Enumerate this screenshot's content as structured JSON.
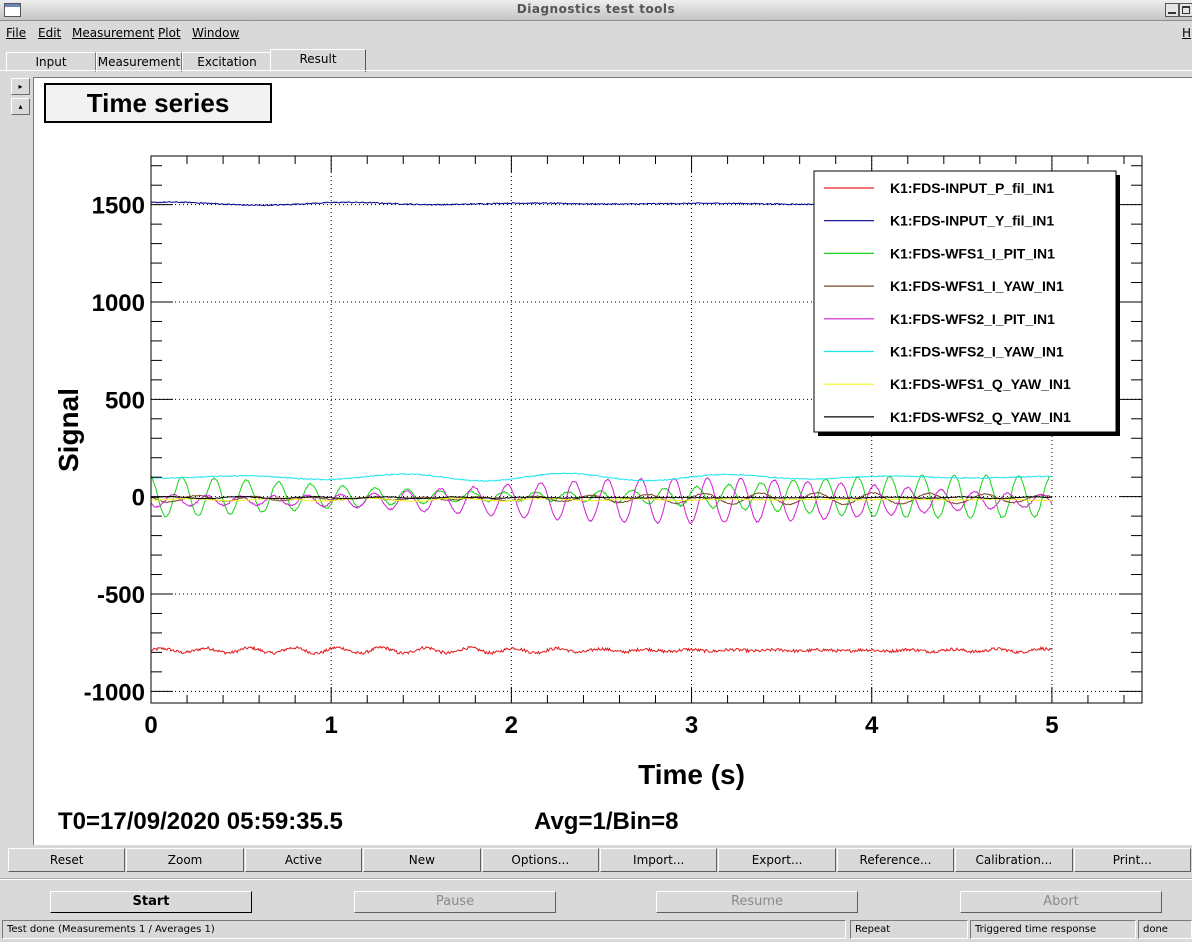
{
  "window": {
    "title": "Diagnostics test tools"
  },
  "menu": [
    {
      "label": "File"
    },
    {
      "label": "Edit"
    },
    {
      "label": "Measurement"
    },
    {
      "label": "Plot"
    },
    {
      "label": "Window"
    },
    {
      "label": "H"
    }
  ],
  "tabs": [
    {
      "label": "Input"
    },
    {
      "label": "Measurement"
    },
    {
      "label": "Excitation"
    },
    {
      "label": "Result",
      "active": true
    }
  ],
  "sidebar": {
    "expand_glyph": "▸",
    "collapse_glyph": "▴"
  },
  "panel": {
    "title": "Time series",
    "info_t0": "T0=17/09/2020 05:59:35.5",
    "info_avg": "Avg=1/Bin=8"
  },
  "chart_data": {
    "type": "line",
    "xlabel": "Time (s)",
    "ylabel": "Signal",
    "xlim": [
      0,
      5.5
    ],
    "ylim": [
      -1060,
      1750
    ],
    "xticks": [
      "0",
      "1",
      "2",
      "3",
      "4",
      "5"
    ],
    "yticks": [
      "-1000",
      "-500",
      "0",
      "500",
      "1000",
      "1500"
    ],
    "grid": true,
    "legend_position": "top-right",
    "x_end": 5.0,
    "series": [
      {
        "name": "K1:FDS-INPUT_P_fil_IN1",
        "color": "#e31a1a",
        "base": -790,
        "amp": 15,
        "noise": 8,
        "freq": 4.1
      },
      {
        "name": "K1:FDS-INPUT_Y_fil_IN1",
        "color": "#00008b",
        "base": 1505,
        "amp": 8,
        "noise": 3,
        "freq": 1.0
      },
      {
        "name": "K1:FDS-WFS1_I_PIT_IN1",
        "color": "#17d217",
        "base": 0,
        "amp": 110,
        "noise": 4,
        "freq": 5.6
      },
      {
        "name": "K1:FDS-WFS1_I_YAW_IN1",
        "color": "#7a4a2c",
        "base": -10,
        "amp": 30,
        "noise": 3,
        "freq": 3.2
      },
      {
        "name": "K1:FDS-WFS2_I_PIT_IN1",
        "color": "#d21ed2",
        "base": -20,
        "amp": 115,
        "noise": 4,
        "freq": 5.4
      },
      {
        "name": "K1:FDS-WFS2_I_YAW_IN1",
        "color": "#1ee6ee",
        "base": 100,
        "amp": 20,
        "noise": 3,
        "freq": 1.1
      },
      {
        "name": "K1:FDS-WFS1_Q_YAW_IN1",
        "color": "#f5f51e",
        "base": -15,
        "amp": 8,
        "noise": 2,
        "freq": 2.0
      },
      {
        "name": "K1:FDS-WFS2_Q_YAW_IN1",
        "color": "#000000",
        "base": -5,
        "amp": 5,
        "noise": 2,
        "freq": 2.5
      }
    ]
  },
  "plot_buttons": [
    {
      "label": "Reset"
    },
    {
      "label": "Zoom"
    },
    {
      "label": "Active"
    },
    {
      "label": "New"
    },
    {
      "label": "Options..."
    },
    {
      "label": "Import..."
    },
    {
      "label": "Export..."
    },
    {
      "label": "Reference..."
    },
    {
      "label": "Calibration..."
    },
    {
      "label": "Print..."
    }
  ],
  "controls": [
    {
      "label": "Start",
      "enabled": true
    },
    {
      "label": "Pause",
      "enabled": false
    },
    {
      "label": "Resume",
      "enabled": false
    },
    {
      "label": "Abort",
      "enabled": false
    }
  ],
  "status": {
    "message": "Test done (Measurements 1 / Averages 1)",
    "mode": "Repeat",
    "type": "Triggered time response",
    "state": "done"
  }
}
